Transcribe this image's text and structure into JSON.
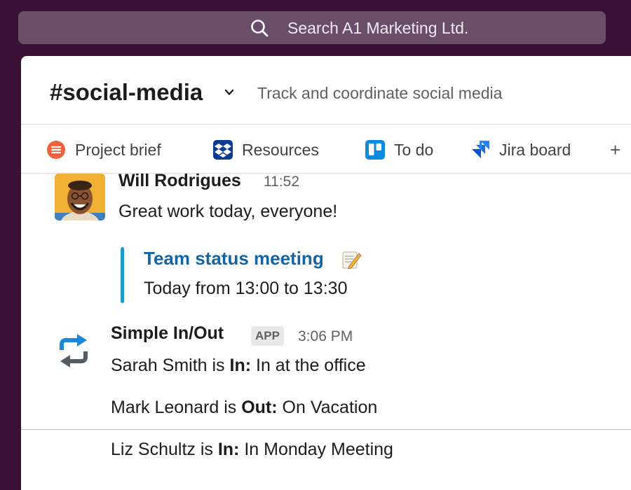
{
  "search": {
    "placeholder": "Search A1 Marketing Ltd."
  },
  "header": {
    "channel_name": "#social-media",
    "topic": "Track and coordinate social media"
  },
  "bookmarks": [
    {
      "label": "Project brief",
      "icon": "quip-icon"
    },
    {
      "label": "Resources",
      "icon": "dropbox-icon"
    },
    {
      "label": "To do",
      "icon": "trello-icon"
    },
    {
      "label": "Jira board",
      "icon": "jira-icon"
    }
  ],
  "add_bookmark": "+",
  "messages": [
    {
      "sender": "Will Rodrigues",
      "time": "11:52",
      "text": "Great work today, everyone!",
      "attachment": {
        "title": "Team status meeting",
        "emoji": "memo",
        "subtitle": "Today from 13:00 to 13:30"
      }
    },
    {
      "sender": "Simple In/Out",
      "badge": "APP",
      "time": "3:06 PM",
      "lines": [
        {
          "name": "Sarah Smith is ",
          "status": "In:",
          "detail": " In at the office"
        },
        {
          "name": "Mark Leonard is ",
          "status": "Out:",
          "detail": " On Vacation"
        },
        {
          "name": "Liz Schultz is ",
          "status": "In:",
          "detail": " In Monday Meeting"
        }
      ]
    }
  ],
  "colors": {
    "sidebar": "#3b1137",
    "search_bg": "#6a4d69",
    "link": "#1264a3",
    "quote_bar": "#1d9bd1",
    "new_messages_line": "#e6a3c3"
  }
}
